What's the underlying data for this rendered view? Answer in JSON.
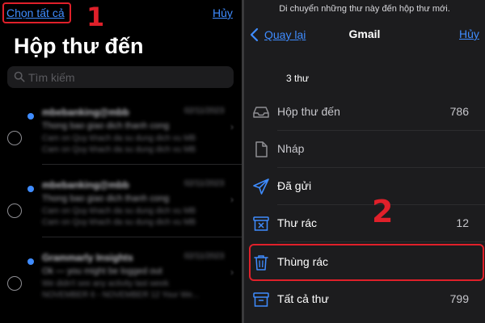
{
  "left": {
    "select_all": "Chọn tất cả",
    "step1": "1",
    "cancel": "Hủy",
    "title": "Hộp thư đến",
    "search_placeholder": "Tìm kiếm",
    "emails": [
      {
        "sender": "mbebanking@mbb",
        "date": "02/11/2023",
        "subject": "Thong bao giao dich thanh cong",
        "preview1": "Cam on Quy khach da su dung dich vu MB",
        "preview2": "Cam on Quy khach da su dung dich vu MB"
      },
      {
        "sender": "mbebanking@mbb",
        "date": "02/11/2023",
        "subject": "Thong bao giao dich thanh cong",
        "preview1": "Cam on Quy khach da su dung dich vu MB",
        "preview2": "Cam on Quy khach da su dung dich vu MB"
      },
      {
        "sender": "Grammarly Insights",
        "date": "02/11/2023",
        "subject": "Ok — you might be logged out",
        "preview1": "We didn't see any activity last week",
        "preview2": "NOVEMBER 6 - NOVEMBER 12 Your We..."
      }
    ]
  },
  "right": {
    "prompt": "Di chuyển những thư này đến hộp thư mới.",
    "back": "Quay lại",
    "title": "Gmail",
    "cancel": "Hủy",
    "count": "3 thư",
    "step2": "2",
    "mailboxes": [
      {
        "label": "Hộp thư đến",
        "count": "786",
        "icon": "inbox-icon",
        "muted": true
      },
      {
        "label": "Nháp",
        "count": "",
        "icon": "draft-icon",
        "muted": true
      },
      {
        "label": "Đã gửi",
        "count": "",
        "icon": "sent-icon",
        "muted": false
      },
      {
        "label": "Thư rác",
        "count": "12",
        "icon": "junk-icon",
        "muted": false
      },
      {
        "label": "Thùng rác",
        "count": "",
        "icon": "trash-icon",
        "muted": false
      },
      {
        "label": "Tất cả thư",
        "count": "799",
        "icon": "archive-icon",
        "muted": false
      }
    ]
  },
  "colors": {
    "accent": "#3f8cff",
    "highlight": "#e0202a",
    "background_left": "#000000",
    "background_right": "#1c1c1e"
  }
}
